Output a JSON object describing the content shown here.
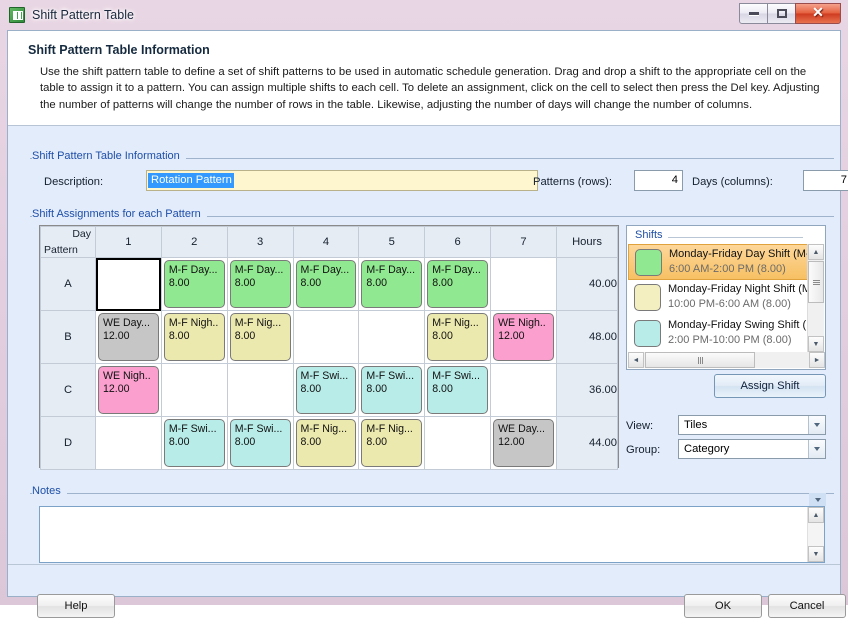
{
  "window": {
    "title": "Shift Pattern Table",
    "icon": "spreadsheet-icon",
    "minimize_label": "",
    "maximize_label": "",
    "close_label": "✕"
  },
  "instructions": {
    "title": "Shift Pattern Table Information",
    "body": "Use the shift pattern table to define a set of shift patterns to be used in automatic schedule generation. Drag and drop a shift to the appropriate cell on the table to assign it to a pattern. You can assign multiple shifts to each cell. To delete an assignment, click on the cell to select then press the Del key.  Adjusting the number of patterns will change the number of rows in the table. Likewise, adjusting the number of days will change the number of columns."
  },
  "info_group": {
    "legend": "Shift Pattern Table Information",
    "description_label": "Description:",
    "description_value": "Rotation Pattern",
    "patterns_label": "Patterns (rows):",
    "patterns_value": "4",
    "days_label": "Days (columns):",
    "days_value": "7"
  },
  "assignments_group": {
    "legend": "Shift Assignments for each Pattern",
    "corner_day_label": "Day",
    "corner_pattern_label": "Pattern",
    "day_headers": [
      "1",
      "2",
      "3",
      "4",
      "5",
      "6",
      "7"
    ],
    "hours_header": "Hours",
    "rows": [
      {
        "pattern": "A",
        "hours": "40.00",
        "cells": [
          {
            "empty": true,
            "selected": true
          },
          {
            "name": "M-F Day...",
            "hours": "8.00",
            "color": "#90e890"
          },
          {
            "name": "M-F Day...",
            "hours": "8.00",
            "color": "#90e890"
          },
          {
            "name": "M-F Day...",
            "hours": "8.00",
            "color": "#90e890"
          },
          {
            "name": "M-F Day...",
            "hours": "8.00",
            "color": "#90e890"
          },
          {
            "name": "M-F Day...",
            "hours": "8.00",
            "color": "#90e890"
          },
          {
            "empty": true
          }
        ]
      },
      {
        "pattern": "B",
        "hours": "48.00",
        "cells": [
          {
            "name": "WE Day...",
            "hours": "12.00",
            "color": "#c6c6c6"
          },
          {
            "name": "M-F Nigh..",
            "hours": "8.00",
            "color": "#ece9ae"
          },
          {
            "name": "M-F Nig...",
            "hours": "8.00",
            "color": "#ece9ae"
          },
          {
            "empty": true
          },
          {
            "empty": true
          },
          {
            "name": "M-F Nig...",
            "hours": "8.00",
            "color": "#ece9ae"
          },
          {
            "name": "WE Nigh..",
            "hours": "12.00",
            "color": "#fba0ce"
          }
        ]
      },
      {
        "pattern": "C",
        "hours": "36.00",
        "cells": [
          {
            "name": "WE Nigh..",
            "hours": "12.00",
            "color": "#fba0ce"
          },
          {
            "empty": true
          },
          {
            "empty": true
          },
          {
            "name": "M-F Swi...",
            "hours": "8.00",
            "color": "#b7ece8"
          },
          {
            "name": "M-F Swi...",
            "hours": "8.00",
            "color": "#b7ece8"
          },
          {
            "name": "M-F Swi...",
            "hours": "8.00",
            "color": "#b7ece8"
          },
          {
            "empty": true
          }
        ]
      },
      {
        "pattern": "D",
        "hours": "44.00",
        "cells": [
          {
            "empty": true
          },
          {
            "name": "M-F Swi...",
            "hours": "8.00",
            "color": "#b7ece8"
          },
          {
            "name": "M-F Swi...",
            "hours": "8.00",
            "color": "#b7ece8"
          },
          {
            "name": "M-F Nig...",
            "hours": "8.00",
            "color": "#ece9ae"
          },
          {
            "name": "M-F Nig...",
            "hours": "8.00",
            "color": "#ece9ae"
          },
          {
            "empty": true
          },
          {
            "name": "WE Day...",
            "hours": "12.00",
            "color": "#c6c6c6"
          }
        ]
      }
    ]
  },
  "shifts_panel": {
    "legend": "Shifts",
    "items": [
      {
        "name": "Monday-Friday Day Shift (M-",
        "time": "6:00 AM-2:00 PM (8.00)",
        "color": "#90e890",
        "selected": true
      },
      {
        "name": "Monday-Friday Night Shift (M",
        "time": "10:00 PM-6:00 AM (8.00)",
        "color": "#f4efc0",
        "selected": false
      },
      {
        "name": "Monday-Friday Swing Shift (N",
        "time": "2:00 PM-10:00 PM (8.00)",
        "color": "#b7ece8",
        "selected": false
      }
    ],
    "scroll_up": "▲",
    "scroll_down": "▼",
    "scroll_left": "◄",
    "scroll_right": "►"
  },
  "controls": {
    "assign_shift_label": "Assign Shift",
    "view_label": "View:",
    "view_value": "Tiles",
    "group_label": "Group:",
    "group_value": "Category"
  },
  "notes_group": {
    "legend": "Notes",
    "value": "",
    "scroll_up": "▲",
    "scroll_down": "▼",
    "dropdown": "▼"
  },
  "footer": {
    "help_label": "Help",
    "ok_label": "OK",
    "cancel_label": "Cancel"
  }
}
